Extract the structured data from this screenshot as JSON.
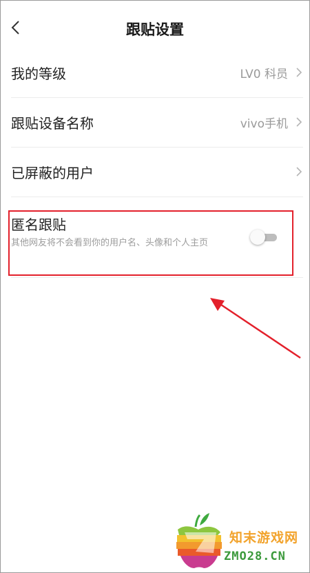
{
  "header": {
    "title": "跟贴设置",
    "back_icon": "chevron-left-icon"
  },
  "settings": [
    {
      "label": "我的等级",
      "value": "LV0 科员"
    },
    {
      "label": "跟贴设备名称",
      "value": "vivo手机"
    },
    {
      "label": "已屏蔽的用户",
      "value": ""
    }
  ],
  "anonymous": {
    "label": "匿名跟贴",
    "description": "其他网友将不会看到你的用户名、头像和个人主页",
    "enabled": false
  },
  "annotation": {
    "color": "#e3202b"
  },
  "watermark": {
    "text_cn": "知末游戏网",
    "text_en": "ZMO28.CN"
  },
  "colors": {
    "accent": "#e3202b",
    "muted": "#9a9a9a",
    "divider": "#ececec"
  }
}
